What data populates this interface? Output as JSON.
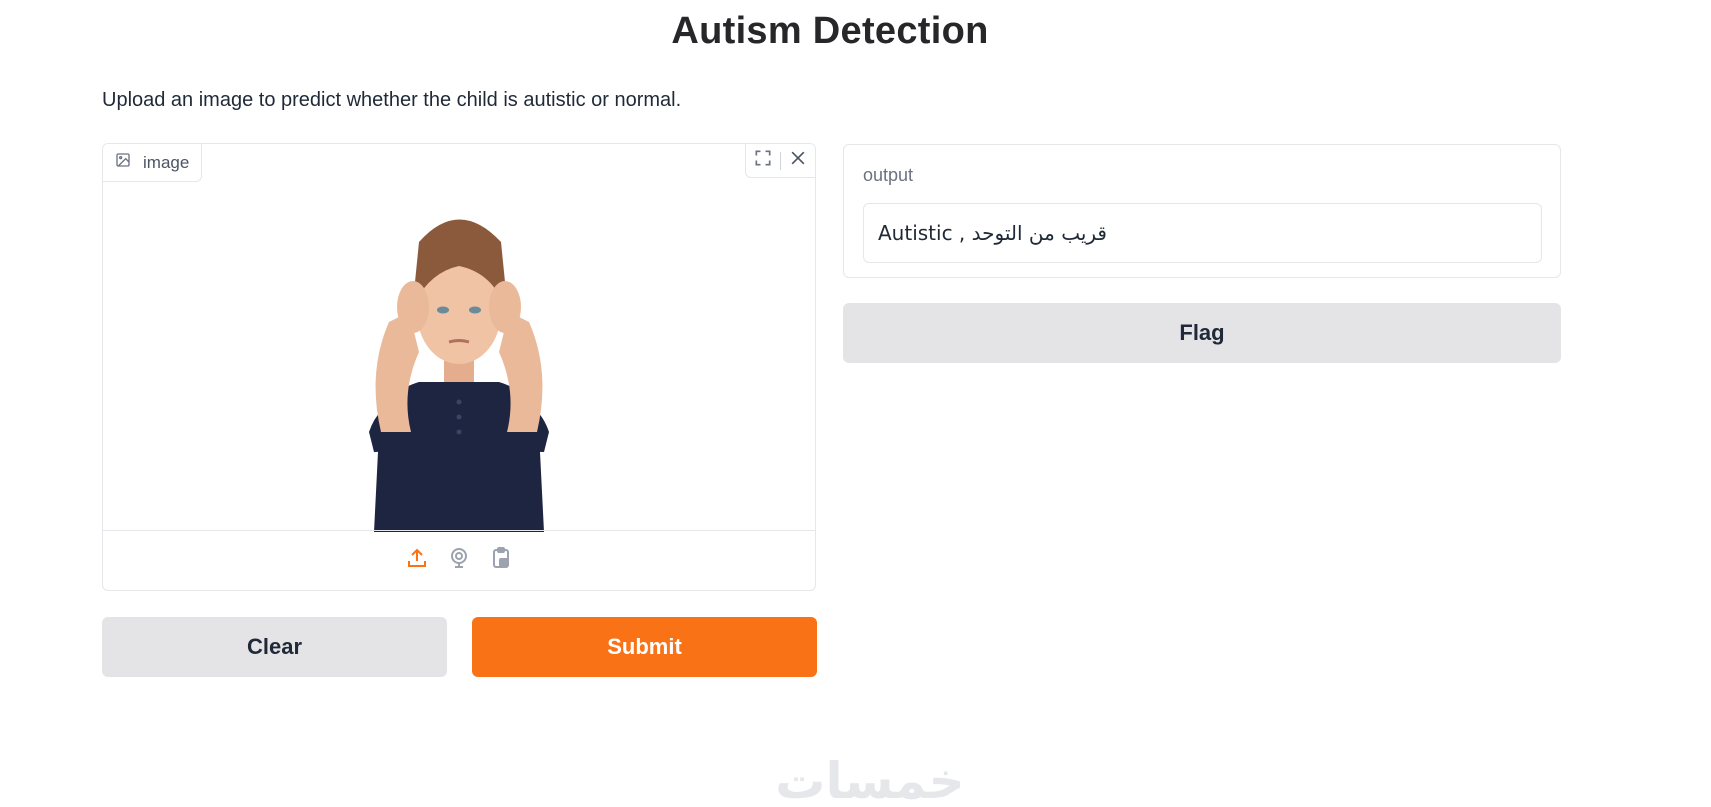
{
  "header": {
    "title": "Autism Detection",
    "description": "Upload an image to predict whether the child is autistic or normal."
  },
  "input": {
    "label": "image",
    "icons": {
      "label_icon": "image-icon",
      "fullscreen": "fullscreen-icon",
      "clear": "close-icon",
      "upload": "upload-icon",
      "webcam": "webcam-icon",
      "clipboard": "clipboard-icon"
    }
  },
  "output": {
    "label": "output",
    "value": "Autistic , قريب من التوحد"
  },
  "buttons": {
    "clear": "Clear",
    "submit": "Submit",
    "flag": "Flag"
  },
  "colors": {
    "accent": "#f97316",
    "secondary_button": "#e4e4e7"
  },
  "watermark": "خمسات"
}
